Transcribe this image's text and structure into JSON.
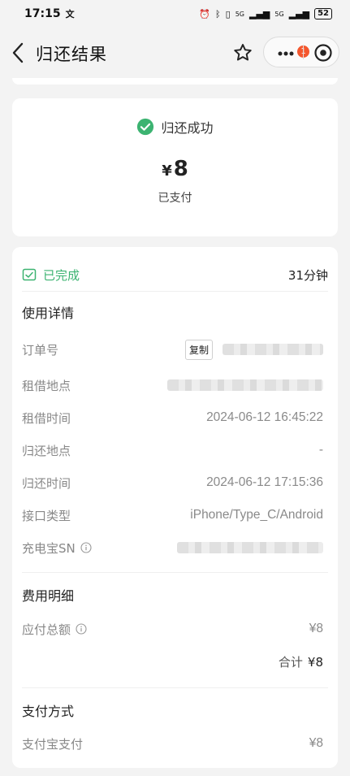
{
  "status_bar": {
    "time": "17:15",
    "signal": "5G",
    "battery": "52"
  },
  "nav": {
    "title": "归还结果",
    "badge_count": "1"
  },
  "result": {
    "success_text": "归还成功",
    "currency": "¥",
    "amount": "8",
    "payment_status": "已支付"
  },
  "order": {
    "status": "已完成",
    "duration": "31分钟",
    "usage_title": "使用详情",
    "copy_label": "复制",
    "rows": [
      {
        "label": "订单号",
        "value": ""
      },
      {
        "label": "租借地点",
        "value": ""
      },
      {
        "label": "租借时间",
        "value": "2024-06-12 16:45:22"
      },
      {
        "label": "归还地点",
        "value": "-"
      },
      {
        "label": "归还时间",
        "value": "2024-06-12 17:15:36"
      },
      {
        "label": "接口类型",
        "value": "iPhone/Type_C/Android"
      },
      {
        "label": "充电宝SN",
        "value": ""
      }
    ]
  },
  "fees": {
    "title": "费用明细",
    "payable_label": "应付总额",
    "payable_value": "¥8",
    "total_label": "合计",
    "total_value": "¥8"
  },
  "payment": {
    "title": "支付方式",
    "method_label": "支付宝支付",
    "method_value": "¥8"
  },
  "colors": {
    "success": "#3cb371",
    "badge": "#f4572e"
  }
}
